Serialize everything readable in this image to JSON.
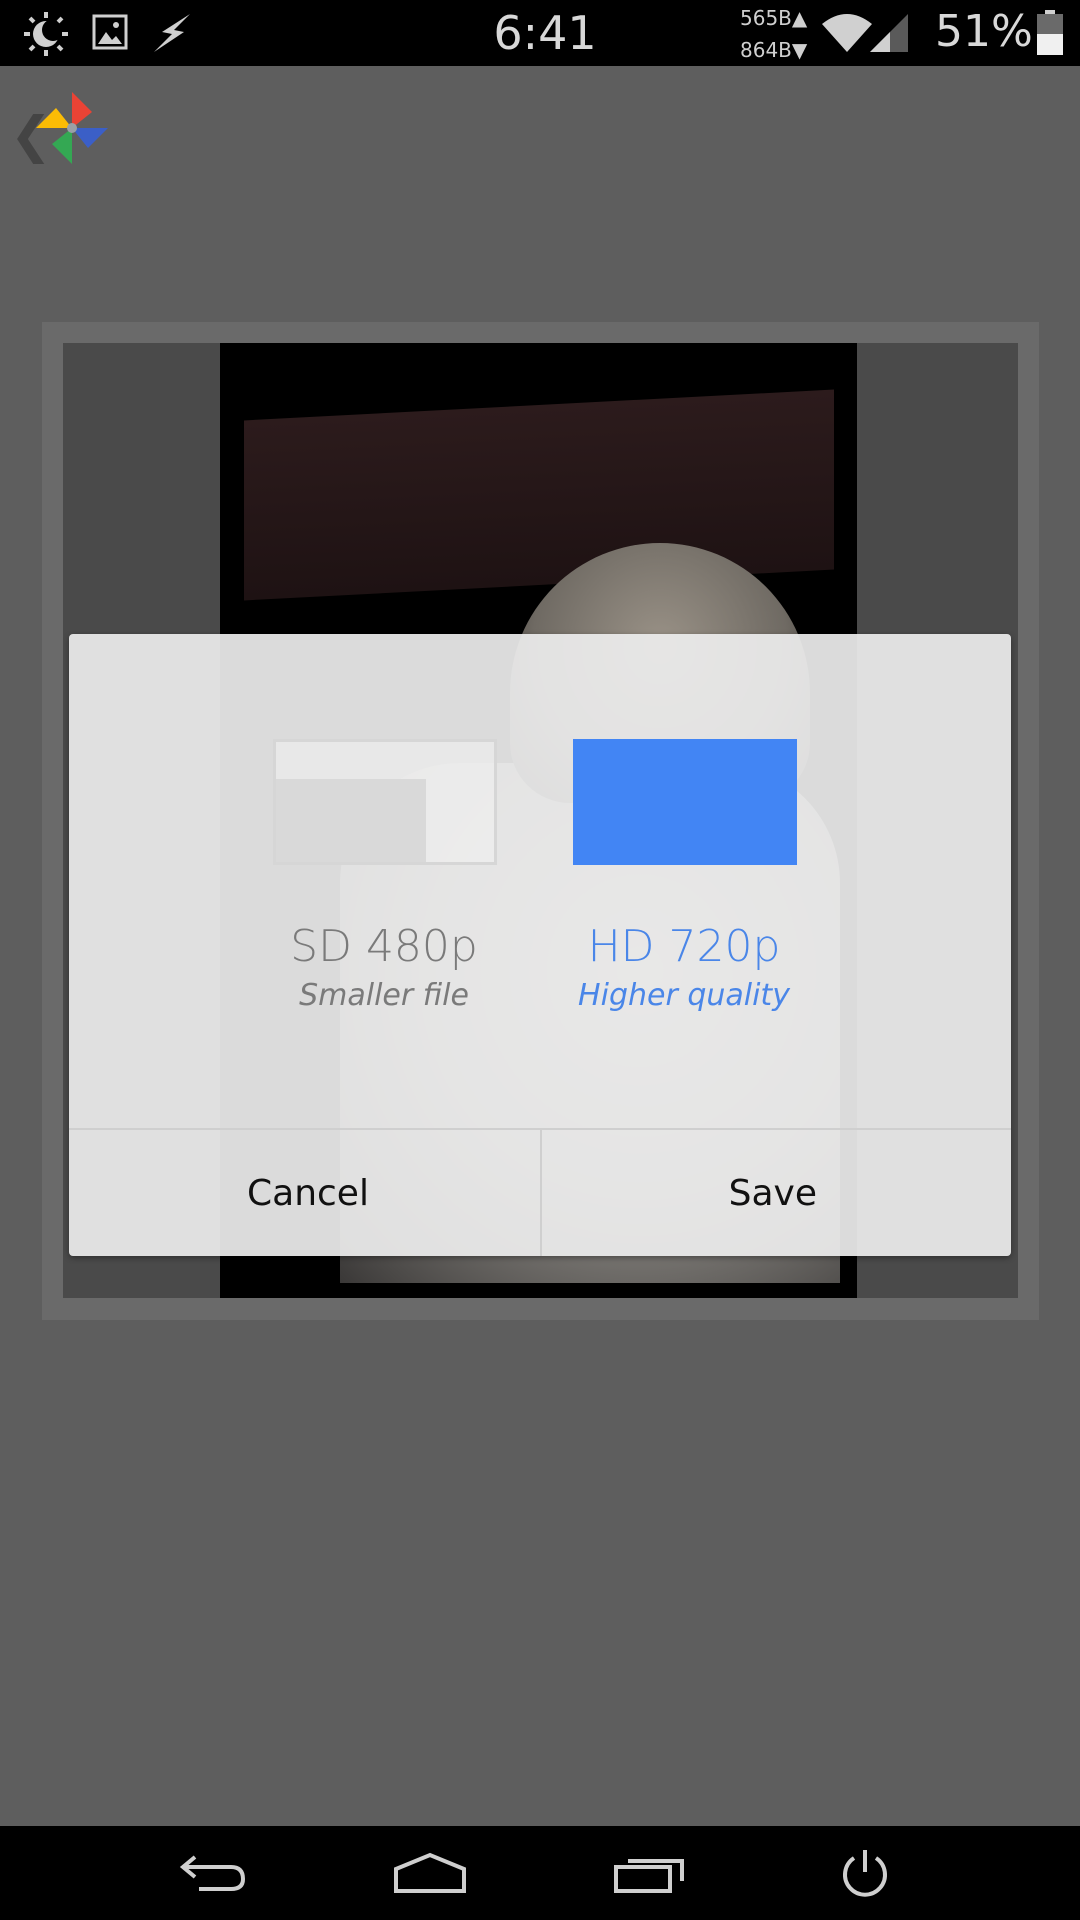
{
  "status_bar": {
    "time": "6:41",
    "net_up": "565B▲",
    "net_down": "864B▼",
    "battery_percent": "51%",
    "icons": [
      "brightness-icon",
      "gallery-icon",
      "flash-icon",
      "wifi-icon",
      "cell-signal-icon",
      "battery-icon"
    ]
  },
  "app_bar": {
    "back_glyph": "❮",
    "logo": "photos-pinwheel-logo"
  },
  "dialog": {
    "options": [
      {
        "title": "SD 480p",
        "subtitle": "Smaller file",
        "selected": false
      },
      {
        "title": "HD 720p",
        "subtitle": "Higher quality",
        "selected": true
      }
    ],
    "cancel_label": "Cancel",
    "save_label": "Save",
    "accent_color": "#4285f4"
  },
  "nav_bar": {
    "icons": [
      "back-icon",
      "home-icon",
      "recents-icon",
      "power-icon"
    ]
  }
}
